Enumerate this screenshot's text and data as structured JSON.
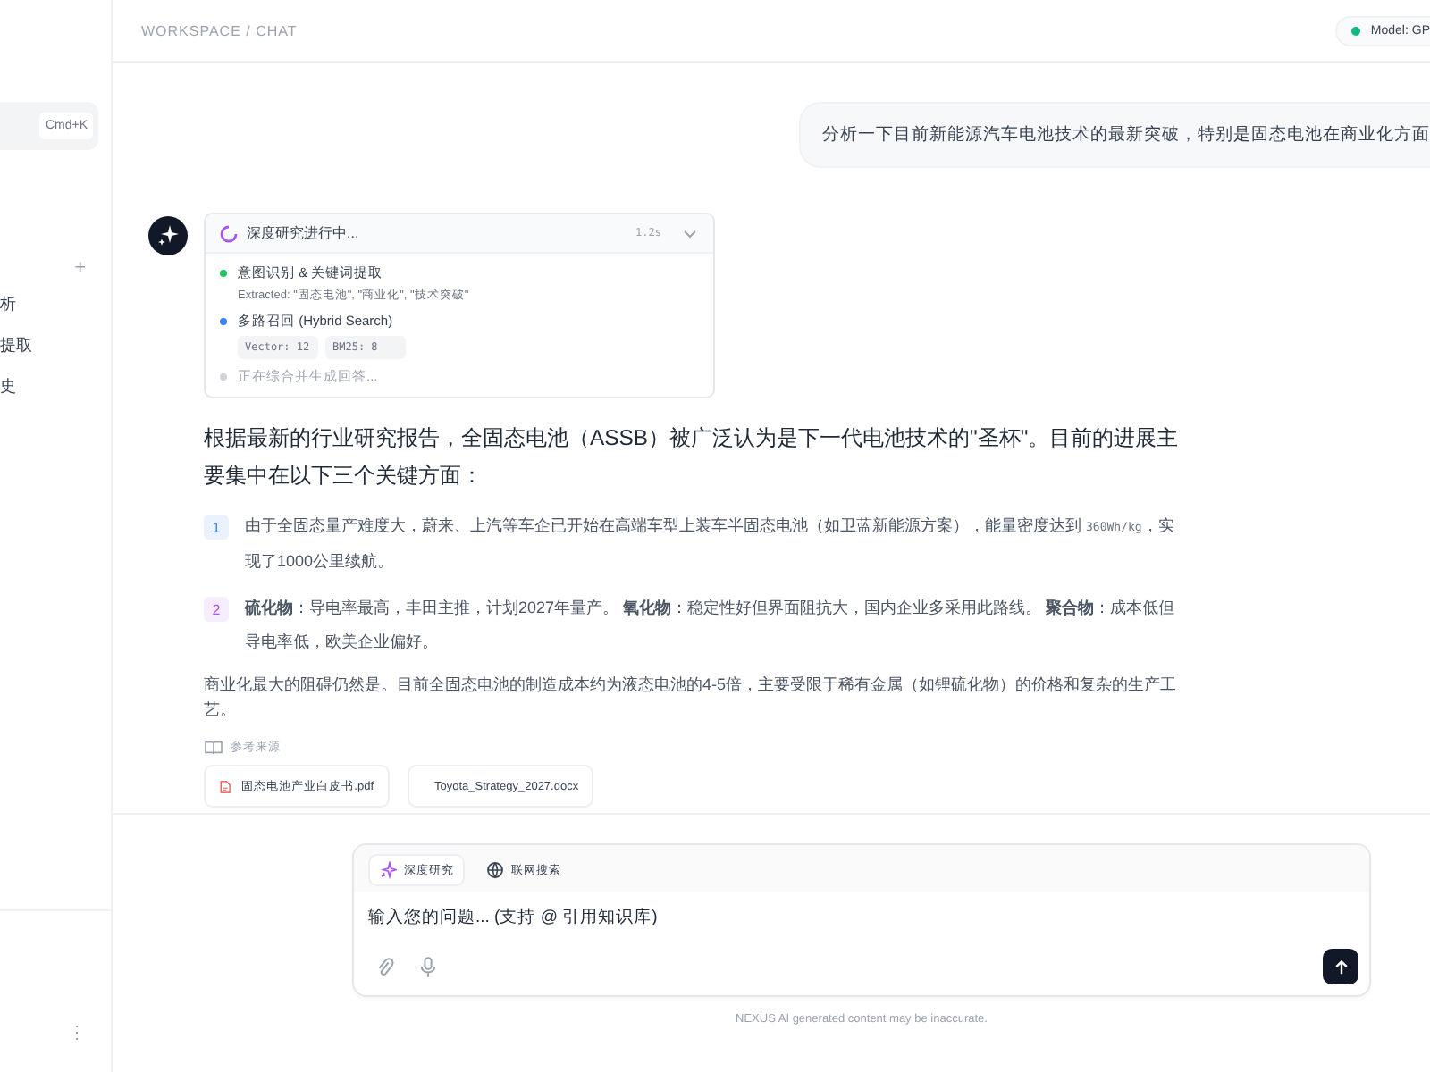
{
  "sidebar": {
    "search": {
      "shortcut": "Cmd+K"
    },
    "section_action": "+",
    "items": [
      {
        "label": "析",
        "selected": false
      },
      {
        "label": "提取",
        "selected": false
      },
      {
        "label": "史",
        "selected": false
      }
    ],
    "menu": "⋮"
  },
  "header": {
    "breadcrumb": "WORKSPACE / CHAT",
    "model": {
      "label": "Model: GP",
      "color": "#10b981"
    }
  },
  "user_message": "分析一下目前新能源汽车电池技术的最新突破，特别是固态电池在商业化方面",
  "research": {
    "title": "深度研究进行中...",
    "time": "1.2s",
    "expanded": true,
    "steps": [
      {
        "kind": "done",
        "title": "意图识别 & 关键词提取",
        "detail": "Extracted: \"固态电池\", \"商业化\", \"技术突破\""
      },
      {
        "kind": "active",
        "title": "多路召回 (Hybrid Search)",
        "chips": [
          "Vector: 12",
          "BM25: 8"
        ]
      },
      {
        "kind": "pending",
        "title": "正在综合并生成回答..."
      }
    ]
  },
  "answer": {
    "intro": "根据最新的行业研究报告，全固态电池（ASSB）被广泛认为是下一代电池技术的\"圣杯\"。目前的进展主要集中在以下三个关键方面：",
    "points": [
      {
        "number": "1",
        "color": "#3b82f6",
        "parts": [
          {
            "kind": "text",
            "text": "由于全固态量产难度大，蔚来、上汽等车企已开始在高端车型上装车半固态电池（如卫蓝新能源方案），能量密度达到 "
          },
          {
            "kind": "code",
            "text": "360Wh/kg"
          },
          {
            "kind": "text",
            "text": "，实现了1000公里续航。"
          }
        ]
      },
      {
        "number": "2",
        "color": "#a855f7",
        "parts": [
          {
            "kind": "text",
            "text": "**硫化物**：导电率最高，丰田主推，计划2027年量产。 **氧化物**：稳定性好但界面阻抗大，国内企业多采用此路线。 **聚合物**：成本低但导电率低，欧美企业偏好。"
          }
        ]
      }
    ],
    "outro": "商业化最大的阻碍仍然是。目前全固态电池的制造成本约为液态电池的4-5倍，主要受限于稀有金属（如锂硫化物）的价格和复杂的生产工艺。",
    "sources_label": "参考来源",
    "sources": [
      {
        "kind": "pdf",
        "name": "固态电池产业白皮书.pdf"
      },
      {
        "kind": "docx",
        "name": "Toyota_Strategy_2027.docx"
      }
    ]
  },
  "composer": {
    "modes": [
      {
        "label": "深度研究",
        "selected": true,
        "kind": "research"
      },
      {
        "label": "联网搜索",
        "selected": false,
        "kind": "web"
      }
    ],
    "placeholder": "输入您的问题... (支持 @ 引用知识库)"
  },
  "disclaimer": "NEXUS AI generated content may be inaccurate."
}
